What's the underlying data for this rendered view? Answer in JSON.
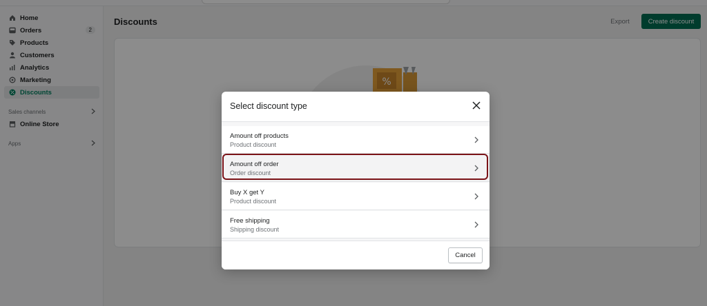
{
  "sidebar": {
    "items": [
      {
        "label": "Home",
        "icon": "home-icon"
      },
      {
        "label": "Orders",
        "icon": "orders-icon",
        "badge": "2"
      },
      {
        "label": "Products",
        "icon": "tag-icon"
      },
      {
        "label": "Customers",
        "icon": "person-icon"
      },
      {
        "label": "Analytics",
        "icon": "bar-chart-icon"
      },
      {
        "label": "Marketing",
        "icon": "target-icon"
      },
      {
        "label": "Discounts",
        "icon": "discount-icon",
        "active": true
      }
    ],
    "sales_channels_label": "Sales channels",
    "online_store_label": "Online Store",
    "apps_label": "Apps"
  },
  "header": {
    "title": "Discounts",
    "export_label": "Export",
    "create_label": "Create discount"
  },
  "modal": {
    "title": "Select discount type",
    "options": [
      {
        "title": "Amount off products",
        "subtitle": "Product discount"
      },
      {
        "title": "Amount off order",
        "subtitle": "Order discount"
      },
      {
        "title": "Buy X get Y",
        "subtitle": "Product discount"
      },
      {
        "title": "Free shipping",
        "subtitle": "Shipping discount"
      }
    ],
    "cancel_label": "Cancel"
  },
  "colors": {
    "primary": "#006e52",
    "active_nav": "#008060",
    "highlight_border": "#7a1217"
  }
}
